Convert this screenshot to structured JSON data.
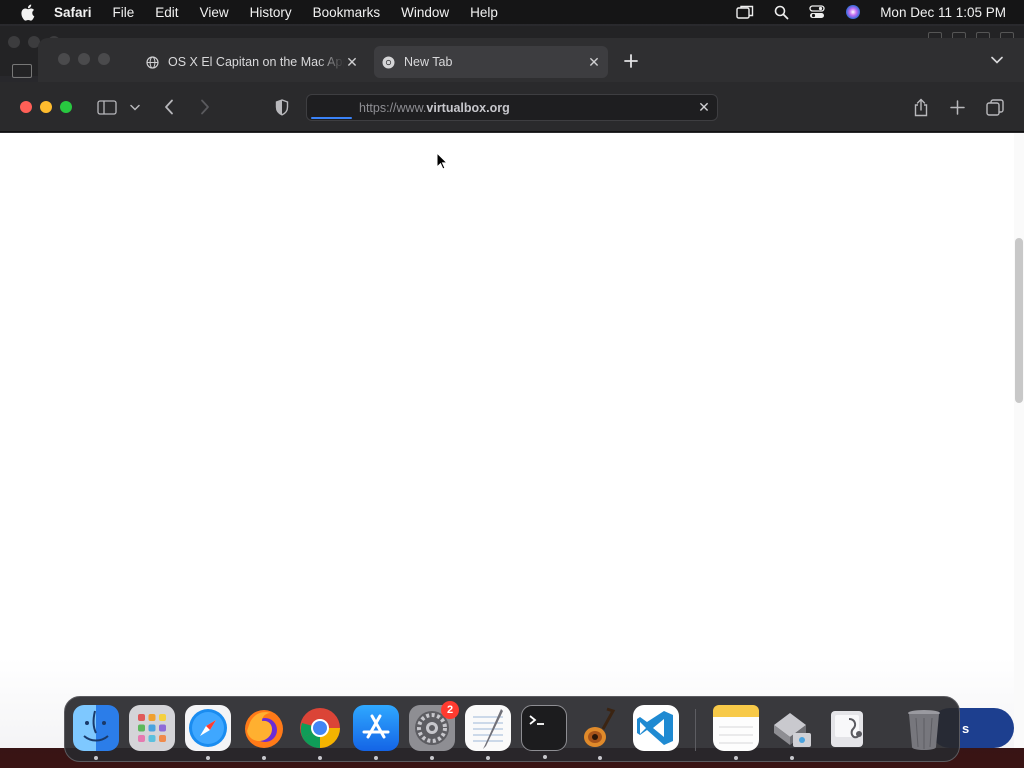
{
  "menubar": {
    "app_name": "Safari",
    "items": [
      "File",
      "Edit",
      "View",
      "History",
      "Bookmarks",
      "Window",
      "Help"
    ],
    "clock": "Mon Dec 11  1:05 PM"
  },
  "tabs": [
    {
      "title": "OS X El Capitan on the Mac App Store",
      "favicon": "globe-icon",
      "active": false
    },
    {
      "title": "New Tab",
      "favicon": "chrome-icon",
      "active": true
    }
  ],
  "addressbar": {
    "url_prefix": "https://www.",
    "url_domain": "virtualbox.org",
    "loading_progress": 0.1
  },
  "page": {
    "floating_button_label": "s",
    "scroll_position": 0.2
  },
  "dock": {
    "apps": [
      {
        "name": "Finder",
        "icon": "finder-icon",
        "running": true
      },
      {
        "name": "Launchpad",
        "icon": "launchpad-icon",
        "running": false
      },
      {
        "name": "Safari",
        "icon": "safari-icon",
        "running": true
      },
      {
        "name": "Firefox",
        "icon": "firefox-icon",
        "running": true
      },
      {
        "name": "Google Chrome",
        "icon": "chrome-icon",
        "running": true
      },
      {
        "name": "App Store",
        "icon": "app-store-icon",
        "running": true
      },
      {
        "name": "System Settings",
        "icon": "system-settings-icon",
        "running": true,
        "badge": "2"
      },
      {
        "name": "TextEdit",
        "icon": "textedit-icon",
        "running": true
      },
      {
        "name": "Terminal",
        "icon": "terminal-icon",
        "running": true
      },
      {
        "name": "GarageBand",
        "icon": "garageband-icon",
        "running": true
      },
      {
        "name": "Visual Studio Code",
        "icon": "vscode-icon",
        "running": false
      },
      {
        "name": "Notes",
        "icon": "notes-icon",
        "running": true
      },
      {
        "name": "Migration Assistant",
        "icon": "migration-icon",
        "running": true
      },
      {
        "name": "Disk Utility",
        "icon": "disk-utility-icon",
        "running": false
      },
      {
        "name": "Trash",
        "icon": "trash-icon",
        "running": false
      }
    ]
  },
  "colors": {
    "accent": "#3a82f7",
    "close": "#ff5f57",
    "minimize": "#febc2e",
    "zoom": "#28c840",
    "badge": "#ff3b30"
  }
}
